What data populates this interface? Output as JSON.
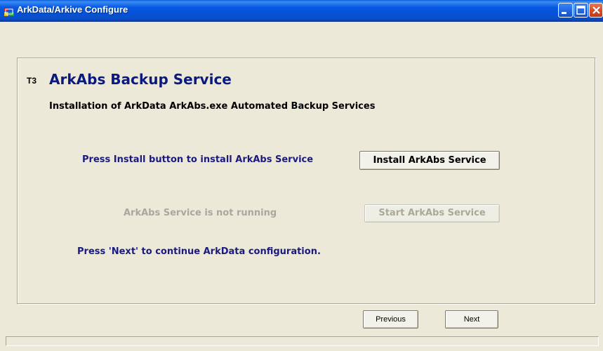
{
  "window": {
    "title": "ArkData/Arkive Configure",
    "app_icon": "app-window-icon",
    "controls": [
      "minimize-icon",
      "maximize-icon",
      "close-icon"
    ]
  },
  "step": {
    "code": "T3",
    "title": "ArkAbs Backup Service",
    "subtitle": "Installation of ArkData ArkAbs.exe Automated Backup Services"
  },
  "install": {
    "instruction": "Press Install button to install ArkAbs Service",
    "button_label": "Install ArkAbs Service"
  },
  "service": {
    "status_text": "ArkAbs Service is not running",
    "start_button_label": "Start ArkAbs Service",
    "start_enabled": false
  },
  "continue_text": "Press 'Next' to continue ArkData configuration.",
  "nav": {
    "previous_label": "Previous",
    "next_label": "Next"
  },
  "colors": {
    "titlebar": "#0758e2",
    "heading": "#0b1a80",
    "instruction": "#1a1a80",
    "disabled_text": "#a9a7a0",
    "window_bg": "#ece9d8",
    "close_button": "#d94d26"
  }
}
